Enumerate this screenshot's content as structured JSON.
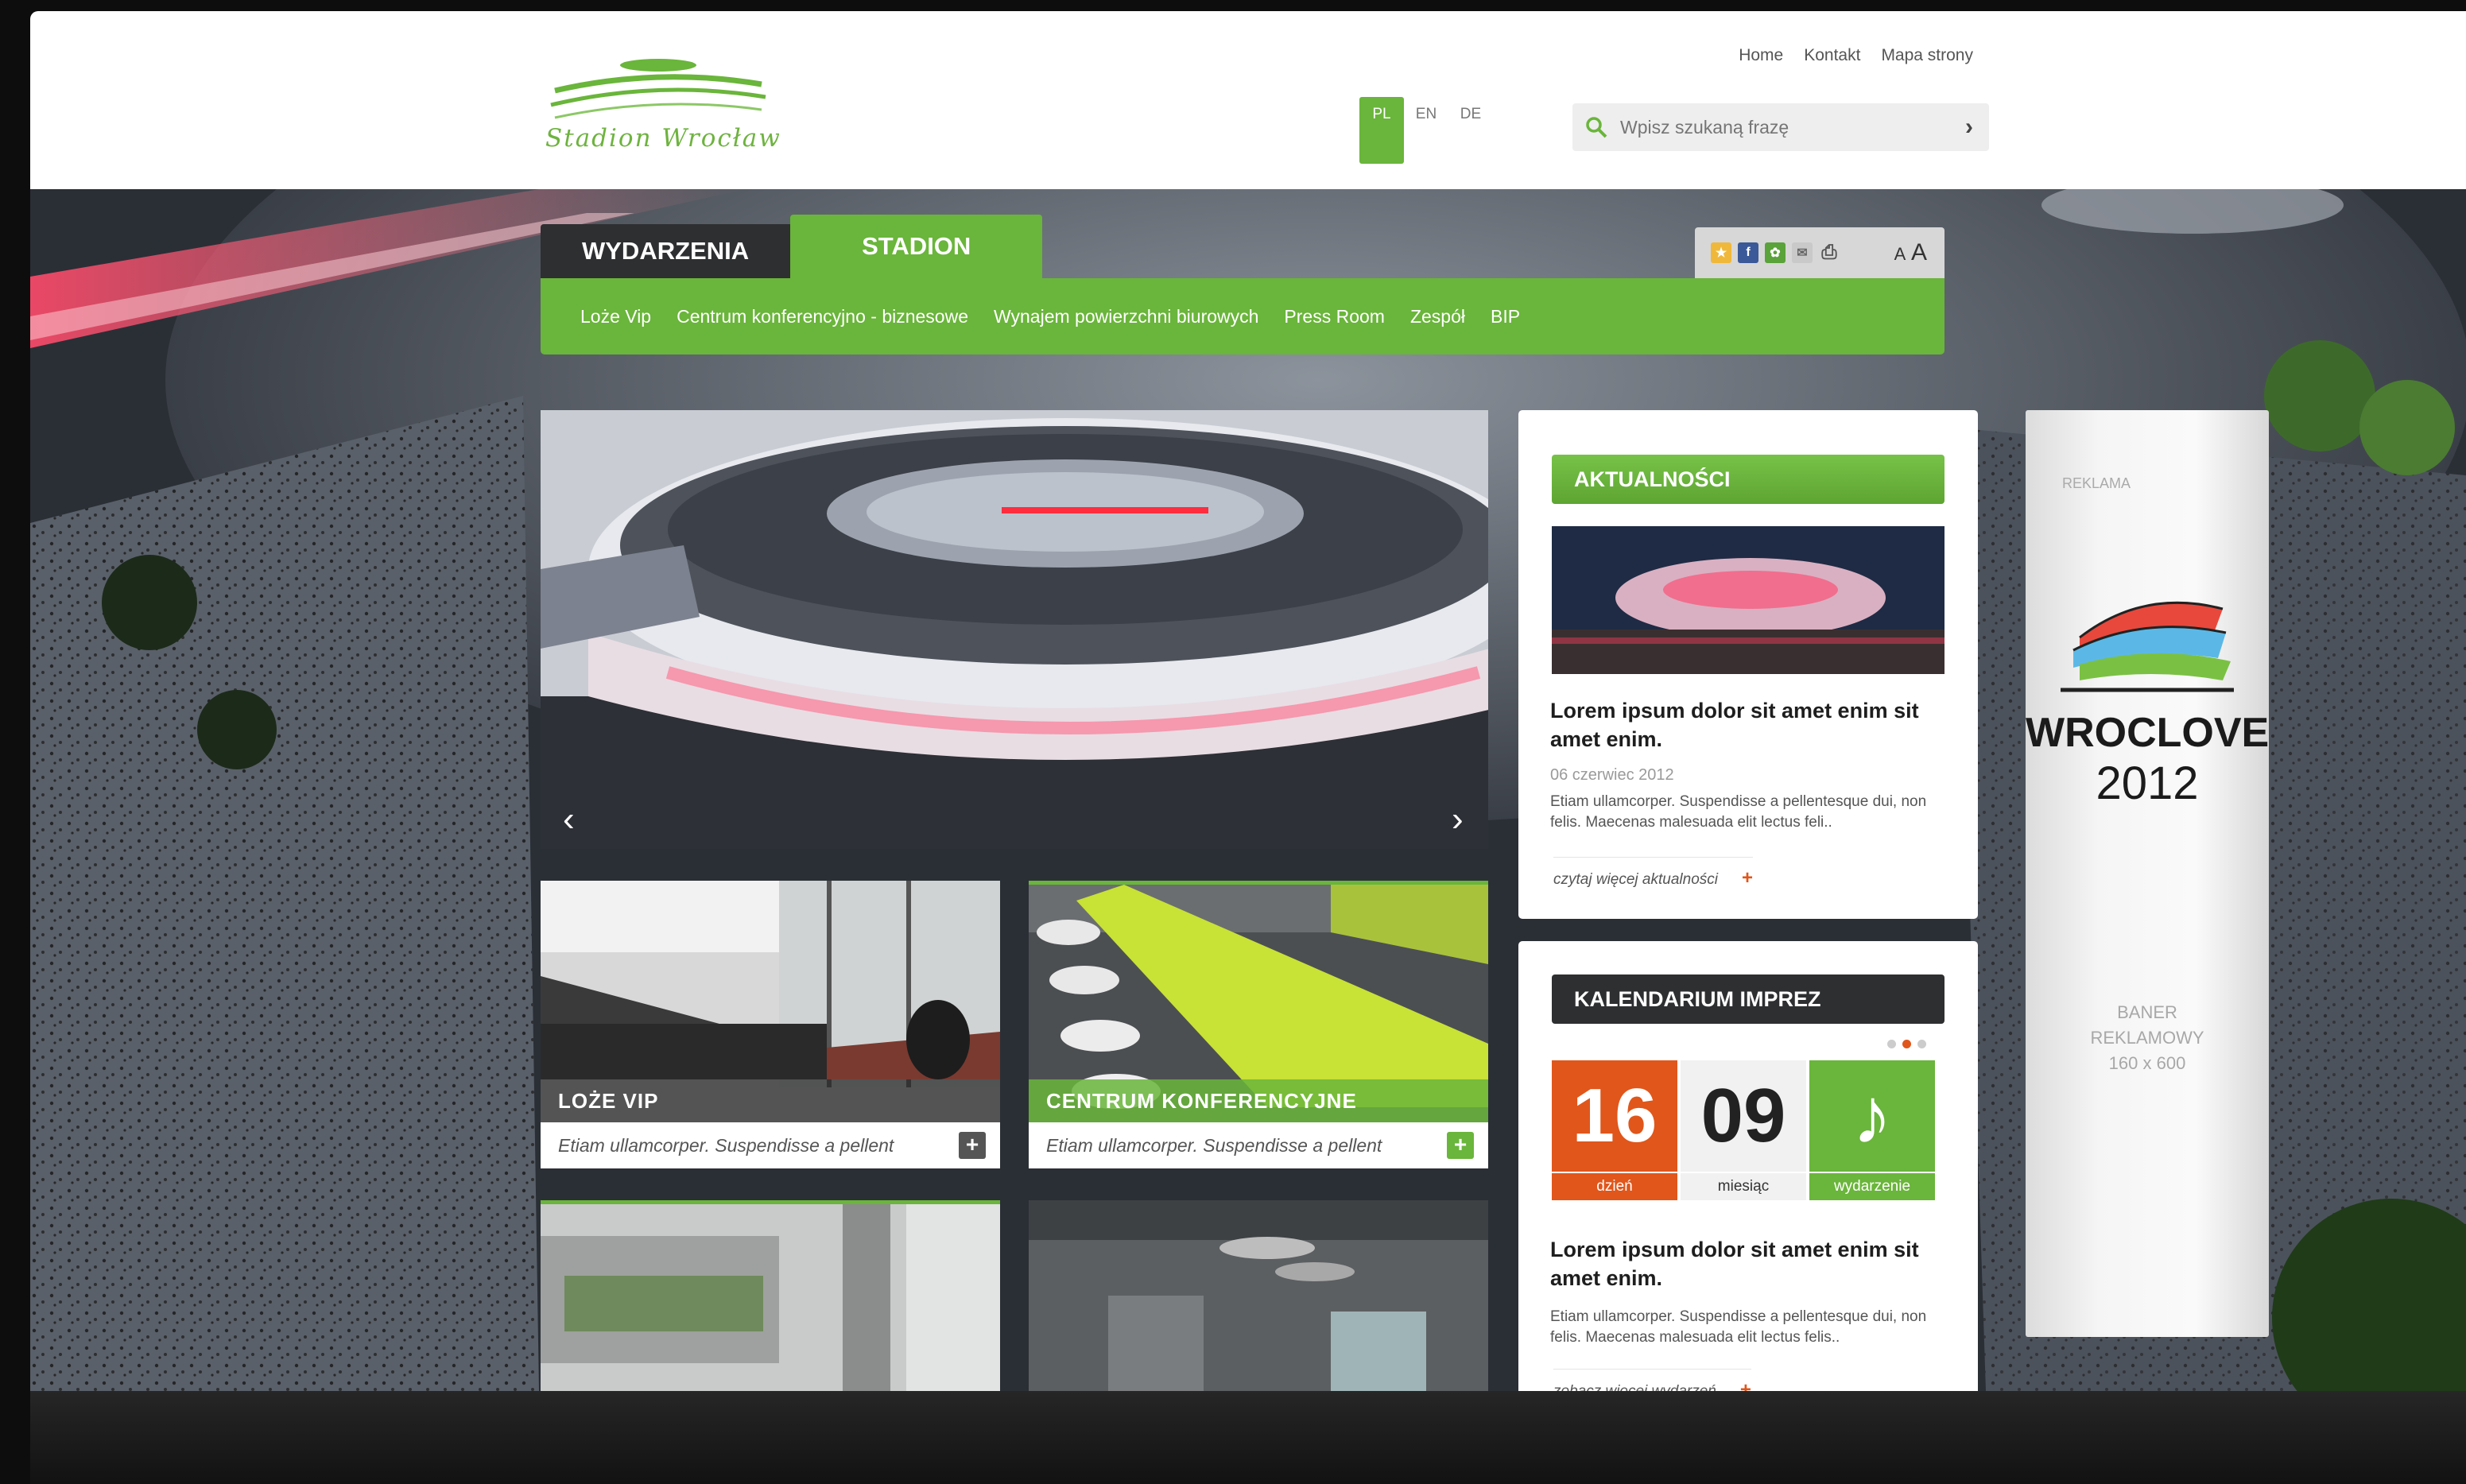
{
  "header": {
    "logo_text": "Stadion Wrocław",
    "top_links": [
      "Home",
      "Kontakt",
      "Mapa strony"
    ],
    "languages": [
      "PL",
      "EN",
      "DE"
    ],
    "active_language": "PL",
    "search_placeholder": "Wpisz szukaną frazę"
  },
  "nav": {
    "tabs": [
      "WYDARZENIA",
      "STADION"
    ],
    "active_tab": "STADION",
    "subnav": [
      "Loże Vip",
      "Centrum konferencyjno - biznesowe",
      "Wynajem powierzchni biurowych",
      "Press Room",
      "Zespół",
      "BIP"
    ],
    "toolbar_icons": [
      "star-icon",
      "facebook-icon",
      "share-icon",
      "mail-icon",
      "print-icon"
    ],
    "font_size_label_small": "A",
    "font_size_label_large": "A"
  },
  "tiles": [
    {
      "caption": "LOŻE VIP",
      "desc": "Etiam ullamcorper. Suspendisse a pellent"
    },
    {
      "caption": "CENTRUM KONFERENCYJNE",
      "desc": "Etiam ullamcorper. Suspendisse a pellent"
    }
  ],
  "news": {
    "header": "AKTUALNOŚCI",
    "title": "Lorem ipsum dolor sit amet enim sit amet enim.",
    "date": "06 czerwiec 2012",
    "text": "Etiam ullamcorper. Suspendisse a pellentesque dui, non felis. Maecenas malesuada elit lectus feli..",
    "more": "czytaj więcej aktualności"
  },
  "calendar": {
    "header": "KALENDARIUM IMPREZ",
    "day": "16",
    "day_label": "dzień",
    "month": "09",
    "month_label": "miesiąc",
    "event_label": "wydarzenie",
    "event_icon": "music-note-icon",
    "title": "Lorem ipsum dolor sit amet enim sit amet enim.",
    "text": "Etiam ullamcorper. Suspendisse a pellentesque dui, non felis. Maecenas malesuada elit lectus felis..",
    "more": "zobacz więcej wydarzeń"
  },
  "banner": {
    "label": "REKLAMA",
    "title": "WROCLOVE",
    "year": "2012",
    "size_line1": "BANER",
    "size_line2": "REKLAMOWY",
    "size_line3": "160 x 600"
  },
  "colors": {
    "green": "#6ab53b",
    "dark": "#2e2f31",
    "orange": "#e0561b"
  }
}
